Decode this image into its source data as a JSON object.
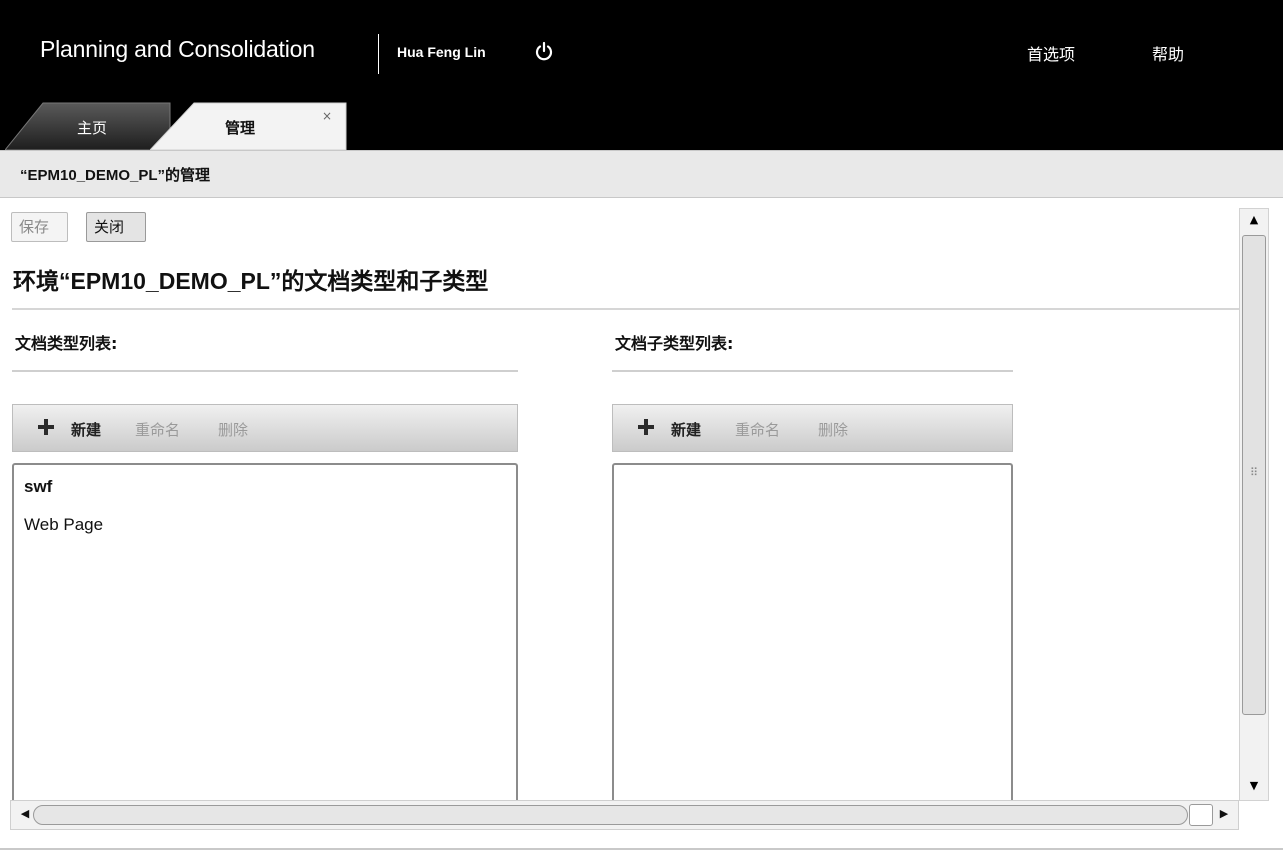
{
  "header": {
    "app_title": "Planning and Consolidation",
    "user_name": "Hua Feng Lin",
    "power_icon": "power-icon",
    "preferences_label": "首选项",
    "help_label": "帮助"
  },
  "tabs": [
    {
      "label": "主页",
      "active": false
    },
    {
      "label": "管理",
      "active": true,
      "close_label": "×"
    }
  ],
  "title_bar": {
    "text": "“EPM10_DEMO_PL”的管理"
  },
  "toolbar": {
    "save_label": "保存",
    "close_label": "关闭"
  },
  "section": {
    "title": "环境“EPM10_DEMO_PL”的文档类型和子类型"
  },
  "doc_types": {
    "label": "文档类型列表:",
    "actions": {
      "add_icon": "plus-icon",
      "new": "新建",
      "rename": "重命名",
      "delete": "删除"
    },
    "items": [
      {
        "label": "swf",
        "bold": true
      },
      {
        "label": "Web Page",
        "bold": false
      }
    ]
  },
  "doc_subtypes": {
    "label": "文档子类型列表:",
    "actions": {
      "add_icon": "plus-icon",
      "new": "新建",
      "rename": "重命名",
      "delete": "删除"
    },
    "items": []
  },
  "scrollbars": {
    "up_arrow": "▲",
    "down_arrow": "▼",
    "left_arrow": "◀",
    "right_arrow": "▶",
    "grip": "⠿"
  },
  "colors": {
    "header_bg": "#000000",
    "title_bar_bg": "#e9e9e9",
    "toolbar_gradient_top": "#f0f0f0",
    "toolbar_gradient_bottom": "#cbcbcb"
  }
}
